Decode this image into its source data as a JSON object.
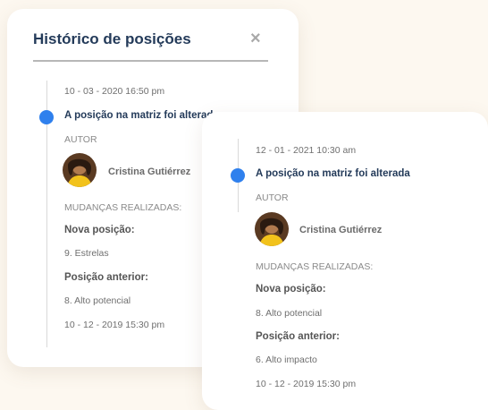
{
  "panel": {
    "title": "Histórico de posições",
    "close_glyph": "×"
  },
  "back_entry": {
    "date": "10 - 03 - 2020 16:50 pm",
    "headline": "A posição na matriz foi alterada",
    "author_label": "AUTOR",
    "author_name": "Cristina Gutiérrez",
    "changes_label": "MUDANÇAS REALIZADAS:",
    "new_position_label": "Nova posição:",
    "new_position_value": "9. Estrelas",
    "previous_position_label": "Posição anterior:",
    "previous_position_value": "8. Alto potencial",
    "footer_date": "10 - 12 - 2019 15:30 pm"
  },
  "front_entry": {
    "date": "12 - 01 - 2021 10:30 am",
    "headline": "A posição na matriz foi alterada",
    "author_label": "AUTOR",
    "author_name": "Cristina Gutiérrez",
    "changes_label": "MUDANÇAS REALIZADAS:",
    "new_position_label": "Nova posição:",
    "new_position_value": "8. Alto potencial",
    "previous_position_label": "Posição anterior:",
    "previous_position_value": "6. Alto impacto",
    "footer_date": "10 - 12 - 2019 15:30 pm"
  },
  "colors": {
    "accent": "#2f80ed",
    "title": "#243b5a",
    "background": "#fdf8f0"
  }
}
